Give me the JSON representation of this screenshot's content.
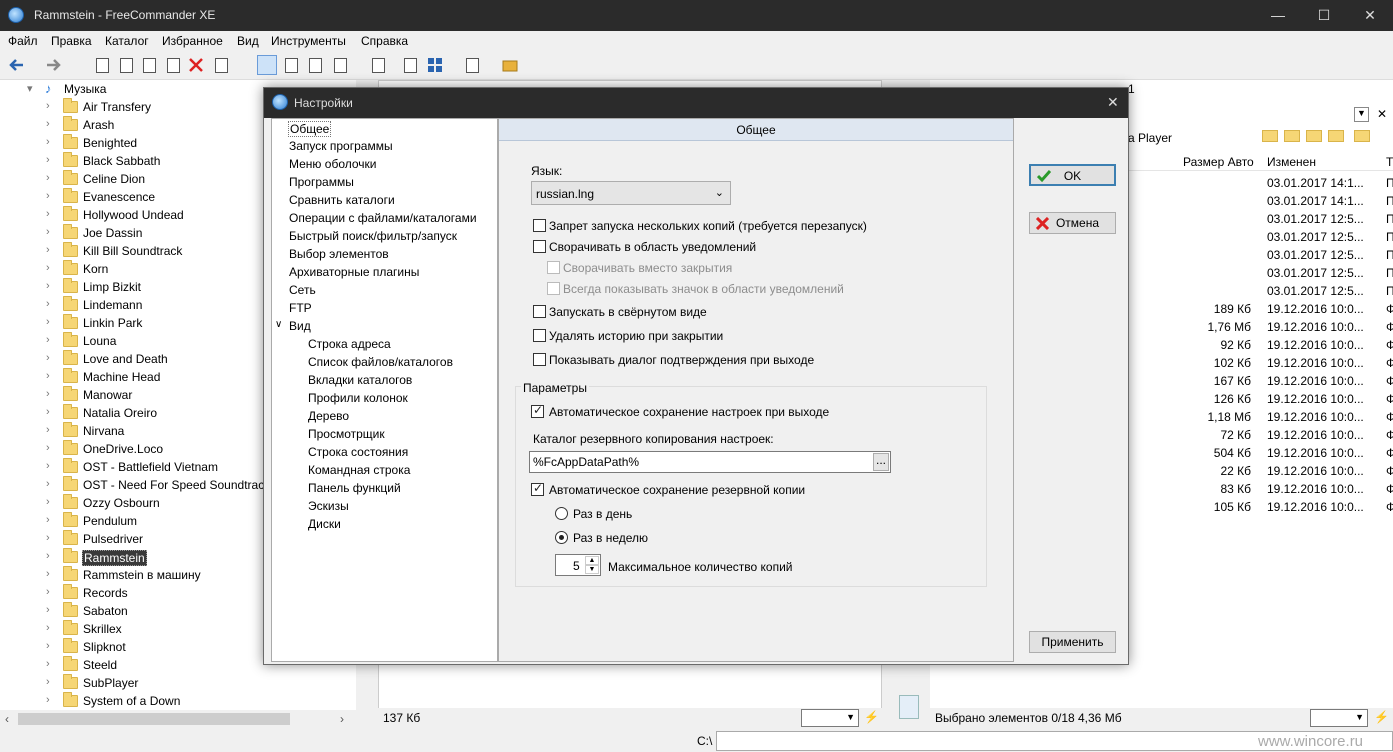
{
  "window": {
    "title": "Rammstein - FreeCommander XE",
    "min": "—",
    "max": "☐",
    "close": "✕"
  },
  "menu": [
    "Файл",
    "Правка",
    "Каталог",
    "Избранное",
    "Вид",
    "Инструменты",
    "Справка"
  ],
  "tree": {
    "root": "Музыка",
    "items": [
      "Air Transfery",
      "Arash",
      "Benighted",
      "Black Sabbath",
      "Celine Dion",
      "Evanescence",
      "Hollywood Undead",
      "Joe Dassin",
      "Kill Bill Soundtrack",
      "Korn",
      "Limp Bizkit",
      "Lindemann",
      "Linkin Park",
      "Louna",
      "Love and Death",
      "Machine Head",
      "Manowar",
      "Natalia Oreiro",
      "Nirvana",
      "OneDrive.Loco",
      "OST - Battlefield Vietnam",
      "OST - Need For Speed Soundtrack",
      "Ozzy Osbourn",
      "Pendulum",
      "Pulsedriver",
      "Rammstein",
      "Rammstein в машину",
      "Records",
      "Sabaton",
      "Skrillex",
      "Slipknot",
      "Steeld",
      "SubPlayer",
      "System of a Down"
    ],
    "selected": "Rammstein"
  },
  "right": {
    "tabnum": "1",
    "path_end": "a Player",
    "headers": {
      "size": "Размер Авто",
      "modified": "Изменен",
      "t": "Т"
    },
    "rows": [
      {
        "size": "",
        "date": "03.01.2017 14:1...",
        "t": "П"
      },
      {
        "size": "",
        "date": "03.01.2017 14:1...",
        "t": "П"
      },
      {
        "size": "",
        "date": "03.01.2017 12:5...",
        "t": "П"
      },
      {
        "size": "",
        "date": "03.01.2017 12:5...",
        "t": "П"
      },
      {
        "size": "",
        "date": "03.01.2017 12:5...",
        "t": "П"
      },
      {
        "size": "",
        "date": "03.01.2017 12:5...",
        "t": "П"
      },
      {
        "size": "",
        "date": "03.01.2017 12:5...",
        "t": "П"
      },
      {
        "size": "189 Кб",
        "date": "19.12.2016 10:0...",
        "t": "Ф"
      },
      {
        "size": "1,76 Мб",
        "date": "19.12.2016 10:0...",
        "t": "Ф"
      },
      {
        "size": "92 Кб",
        "date": "19.12.2016 10:0...",
        "t": "Ф"
      },
      {
        "size": "102 Кб",
        "date": "19.12.2016 10:0...",
        "t": "Ф"
      },
      {
        "size": "167 Кб",
        "date": "19.12.2016 10:0...",
        "t": "Ф"
      },
      {
        "size": "126 Кб",
        "date": "19.12.2016 10:0...",
        "t": "Ф"
      },
      {
        "size": "1,18 Мб",
        "date": "19.12.2016 10:0...",
        "t": "Ф"
      },
      {
        "size": "72 Кб",
        "date": "19.12.2016 10:0...",
        "t": "Ф"
      },
      {
        "size": "504 Кб",
        "date": "19.12.2016 10:0...",
        "t": "Ф"
      },
      {
        "size": "22 Кб",
        "date": "19.12.2016 10:0...",
        "t": "Ф"
      },
      {
        "size": "83 Кб",
        "date": "19.12.2016 10:0...",
        "t": "Ф"
      },
      {
        "size": "105 Кб",
        "date": "19.12.2016 10:0...",
        "t": "Ф"
      }
    ]
  },
  "status": {
    "left": "137 Кб",
    "right": "Выбрано элементов 0/18   4,36 Мб",
    "cmd": "C:\\",
    "watermark": "www.wincore.ru"
  },
  "dialog": {
    "title": "Настройки",
    "close": "✕",
    "nav": [
      "Общее",
      "Запуск программы",
      "Меню оболочки",
      "Программы",
      "Сравнить каталоги",
      "Операции с файлами/каталогами",
      "Быстрый поиск/фильтр/запуск",
      "Выбор элементов",
      "Архиваторные плагины",
      "Сеть",
      "FTP",
      "Вид"
    ],
    "nav_sub": [
      "Строка адреса",
      "Список файлов/каталогов",
      "Вкладки каталогов",
      "Профили колонок",
      "Дерево",
      "Просмотрщик",
      "Строка состояния",
      "Командная строка",
      "Панель функций",
      "Эскизы",
      "Диски"
    ],
    "header": "Общее",
    "lang_label": "Язык:",
    "lang_value": "russian.lng",
    "opts": [
      {
        "label": "Запрет запуска нескольких копий (требуется перезапуск)",
        "checked": false
      },
      {
        "label": "Сворачивать в область уведомлений",
        "checked": false
      },
      {
        "label": "Сворачивать вместо закрытия",
        "checked": false,
        "disabled": true
      },
      {
        "label": "Всегда показывать значок в области уведомлений",
        "checked": false,
        "disabled": true
      },
      {
        "label": "Запускать в свёрнутом виде",
        "checked": false
      },
      {
        "label": "Удалять историю при закрытии",
        "checked": false
      },
      {
        "label": "Показывать диалог подтверждения при выходе",
        "checked": false
      }
    ],
    "group": "Параметры",
    "autosave": "Автоматическое сохранение настроек при выходе",
    "backup_label": "Каталог резервного копирования настроек:",
    "backup_path": "%FcAppDataPath%",
    "backup_browse": "...",
    "autobackup": "Автоматическое сохранение резервной копии",
    "radio_day": "Раз в день",
    "radio_week": "Раз в неделю",
    "copies_value": "5",
    "copies_label": "Максимальное количество копий",
    "ok": "OK",
    "cancel": "Отмена",
    "apply": "Применить"
  }
}
